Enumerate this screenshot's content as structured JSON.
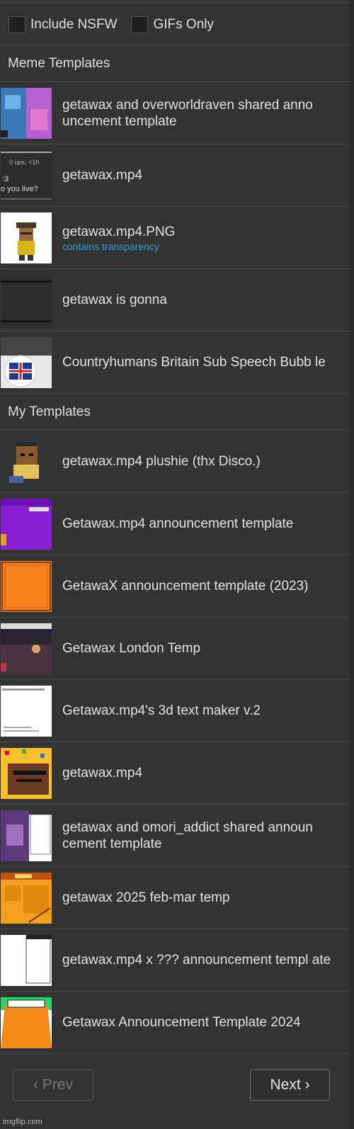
{
  "filters": {
    "nsfw_label": "Include NSFW",
    "gifs_label": "GIFs Only"
  },
  "sections": [
    {
      "title": "Meme Templates",
      "items": [
        {
          "name": "getawax and overworldraven shared anno uncement template",
          "sub": ""
        },
        {
          "name": "getawax.mp4",
          "sub": ""
        },
        {
          "name": "getawax.mp4.PNG",
          "sub": "contains transparency"
        },
        {
          "name": "getawax is gonna",
          "sub": ""
        },
        {
          "name": "Countryhumans Britain Sub Speech Bubb le",
          "sub": ""
        }
      ]
    },
    {
      "title": "My Templates",
      "items": [
        {
          "name": "getawax.mp4 plushie (thx Disco.)",
          "sub": ""
        },
        {
          "name": "Getawax.mp4 announcement template",
          "sub": ""
        },
        {
          "name": "GetawaX announcement template (2023)",
          "sub": ""
        },
        {
          "name": "Getawax London Temp",
          "sub": ""
        },
        {
          "name": "Getawax.mp4's 3d text maker v.2",
          "sub": ""
        },
        {
          "name": "getawax.mp4",
          "sub": ""
        },
        {
          "name": "getawax and omori_addict shared announ cement template",
          "sub": ""
        },
        {
          "name": "getawax 2025 feb-mar temp",
          "sub": ""
        },
        {
          "name": "getawax.mp4 x ??? announcement templ ate",
          "sub": ""
        },
        {
          "name": "Getawax Announcement Template 2024",
          "sub": ""
        }
      ]
    }
  ],
  "thumb_text": {
    "ups": "0 ups, <1h",
    "face": ":3",
    "question": "o you live?"
  },
  "pager": {
    "prev_label": "‹ Prev",
    "next_label": "Next ›"
  },
  "footer": "imgflip.com"
}
